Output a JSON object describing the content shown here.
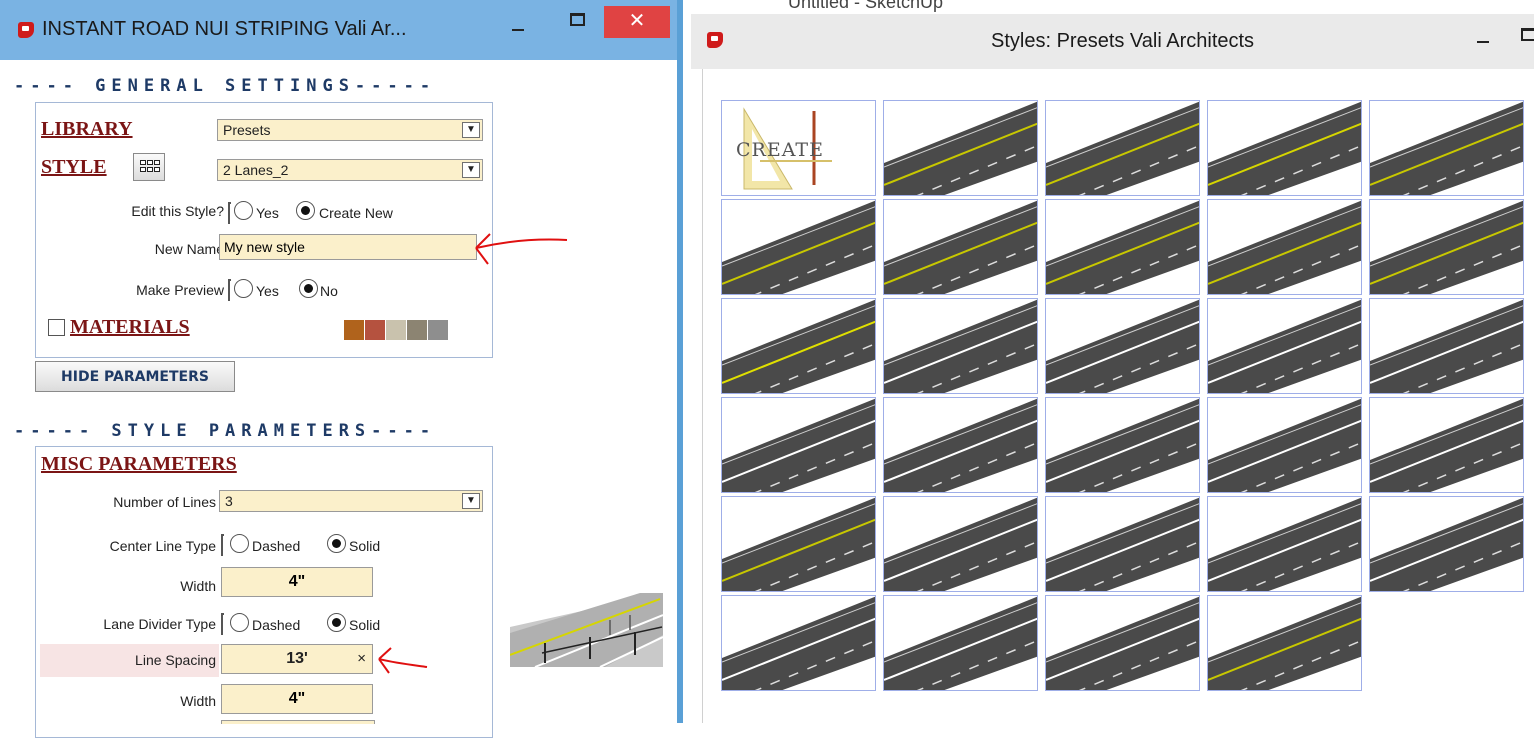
{
  "left_window": {
    "title": "INSTANT ROAD NUI STRIPING  Vali Ar...",
    "close_glyph": "✕",
    "general_settings_heading": "---- GENERAL  SETTINGS-----",
    "library": {
      "label": "LIBRARY",
      "value": "Presets"
    },
    "style": {
      "label": "STYLE",
      "value": "2 Lanes_2"
    },
    "edit_style": {
      "label": "Edit this Style?",
      "options": [
        "Yes",
        "Create New"
      ],
      "selected": "Create New"
    },
    "new_name": {
      "label": "New Name",
      "value": "My new style"
    },
    "make_preview": {
      "label": "Make Preview",
      "options": [
        "Yes",
        "No"
      ],
      "selected": "No"
    },
    "materials": {
      "label": "MATERIALS",
      "checked": false,
      "swatch_colors": [
        "#b0631c",
        "#b5523f",
        "#c9c2ad",
        "#8c8472",
        "#8e8e8e"
      ]
    },
    "hide_parameters_button": "HIDE PARAMETERS",
    "style_parameters_heading": "----- STYLE  PARAMETERS----",
    "misc_parameters": {
      "label": "MISC PARAMETERS",
      "number_of_lines": {
        "label": "Number of Lines",
        "value": "3"
      },
      "center_line_type": {
        "label": "Center Line Type",
        "options": [
          "Dashed",
          "Solid"
        ],
        "selected": "Solid"
      },
      "center_width": {
        "label": "Width",
        "value": "4\""
      },
      "lane_divider_type": {
        "label": "Lane Divider Type",
        "options": [
          "Dashed",
          "Solid"
        ],
        "selected": "Solid"
      },
      "line_spacing": {
        "label": "Line Spacing",
        "value": "13'",
        "clear_glyph": "×"
      },
      "divider_width": {
        "label": "Width",
        "value": "4\""
      }
    }
  },
  "right_window": {
    "background_title": "Untitled - SketchUp",
    "title": "Styles: Presets   Vali Architects",
    "thumbnails": [
      {
        "id": "create",
        "label": "CREATE"
      },
      {
        "id": "p01",
        "stripe": "#c8c800"
      },
      {
        "id": "p02",
        "stripe": "#c8c800"
      },
      {
        "id": "p03",
        "stripe": "#d6d600"
      },
      {
        "id": "p04",
        "stripe": "#c8c800"
      },
      {
        "id": "p05",
        "stripe": "#c8c800"
      },
      {
        "id": "p06",
        "stripe": "#c8c800"
      },
      {
        "id": "p07",
        "stripe": "#c8c800"
      },
      {
        "id": "p08",
        "stripe": "#c8c800"
      },
      {
        "id": "p09",
        "stripe": "#c8c800"
      },
      {
        "id": "p10",
        "stripe": "#e0e000"
      },
      {
        "id": "p11",
        "stripe": "#ffffff"
      },
      {
        "id": "p12",
        "stripe": "#ffffff"
      },
      {
        "id": "p13",
        "stripe": "#ffffff"
      },
      {
        "id": "p14",
        "stripe": "#ffffff"
      },
      {
        "id": "p15",
        "stripe": "#ffffff"
      },
      {
        "id": "p16",
        "stripe": "#ffffff"
      },
      {
        "id": "p17",
        "stripe": "#ffffff"
      },
      {
        "id": "p18",
        "stripe": "#ffffff"
      },
      {
        "id": "p19",
        "stripe": "#ffffff"
      },
      {
        "id": "p20",
        "stripe": "#c8c800"
      },
      {
        "id": "p21",
        "stripe": "#ffffff"
      },
      {
        "id": "p22",
        "stripe": "#ffffff"
      },
      {
        "id": "p23",
        "stripe": "#ffffff"
      },
      {
        "id": "p24",
        "stripe": "#ffffff"
      },
      {
        "id": "p25",
        "stripe": "#ffffff"
      },
      {
        "id": "p26",
        "stripe": "#ffffff"
      },
      {
        "id": "p27",
        "stripe": "#ffffff"
      },
      {
        "id": "p28",
        "stripe": "#c8c800"
      }
    ]
  },
  "colors": {
    "field_bg": "#fbf0cb",
    "label_red": "#7b1515",
    "heading_blue": "#1e3a66",
    "road_gray": "#4a4a4a",
    "annotation_red": "#e01010"
  }
}
